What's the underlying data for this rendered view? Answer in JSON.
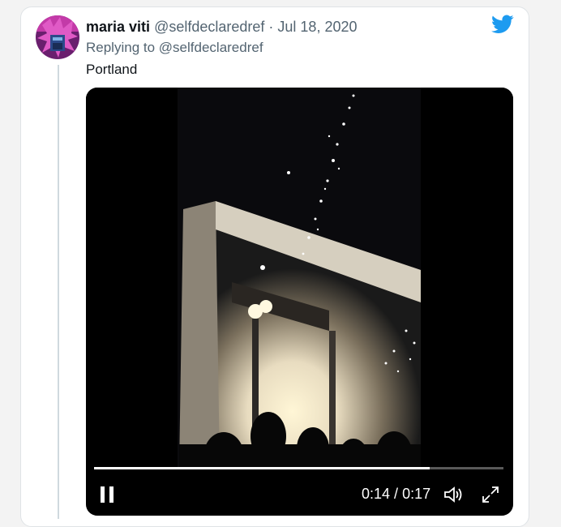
{
  "tweet": {
    "display_name": "maria viti",
    "handle": "@selfdeclaredref",
    "separator": " · ",
    "date": "Jul 18, 2020",
    "reply_prefix": "Replying to",
    "reply_handle": "@selfdeclaredref",
    "text": "Portland"
  },
  "video": {
    "current_time": "0:14",
    "time_separator": " / ",
    "duration": "0:17",
    "progress_fraction": 0.82
  },
  "colors": {
    "brand_blue": "#1d9bf0",
    "text_primary": "#0f1419",
    "text_secondary": "#536471"
  },
  "icons": {
    "brand": "twitter-bird-icon",
    "play_state": "pause-icon",
    "volume": "volume-icon",
    "fullscreen": "fullscreen-icon"
  }
}
